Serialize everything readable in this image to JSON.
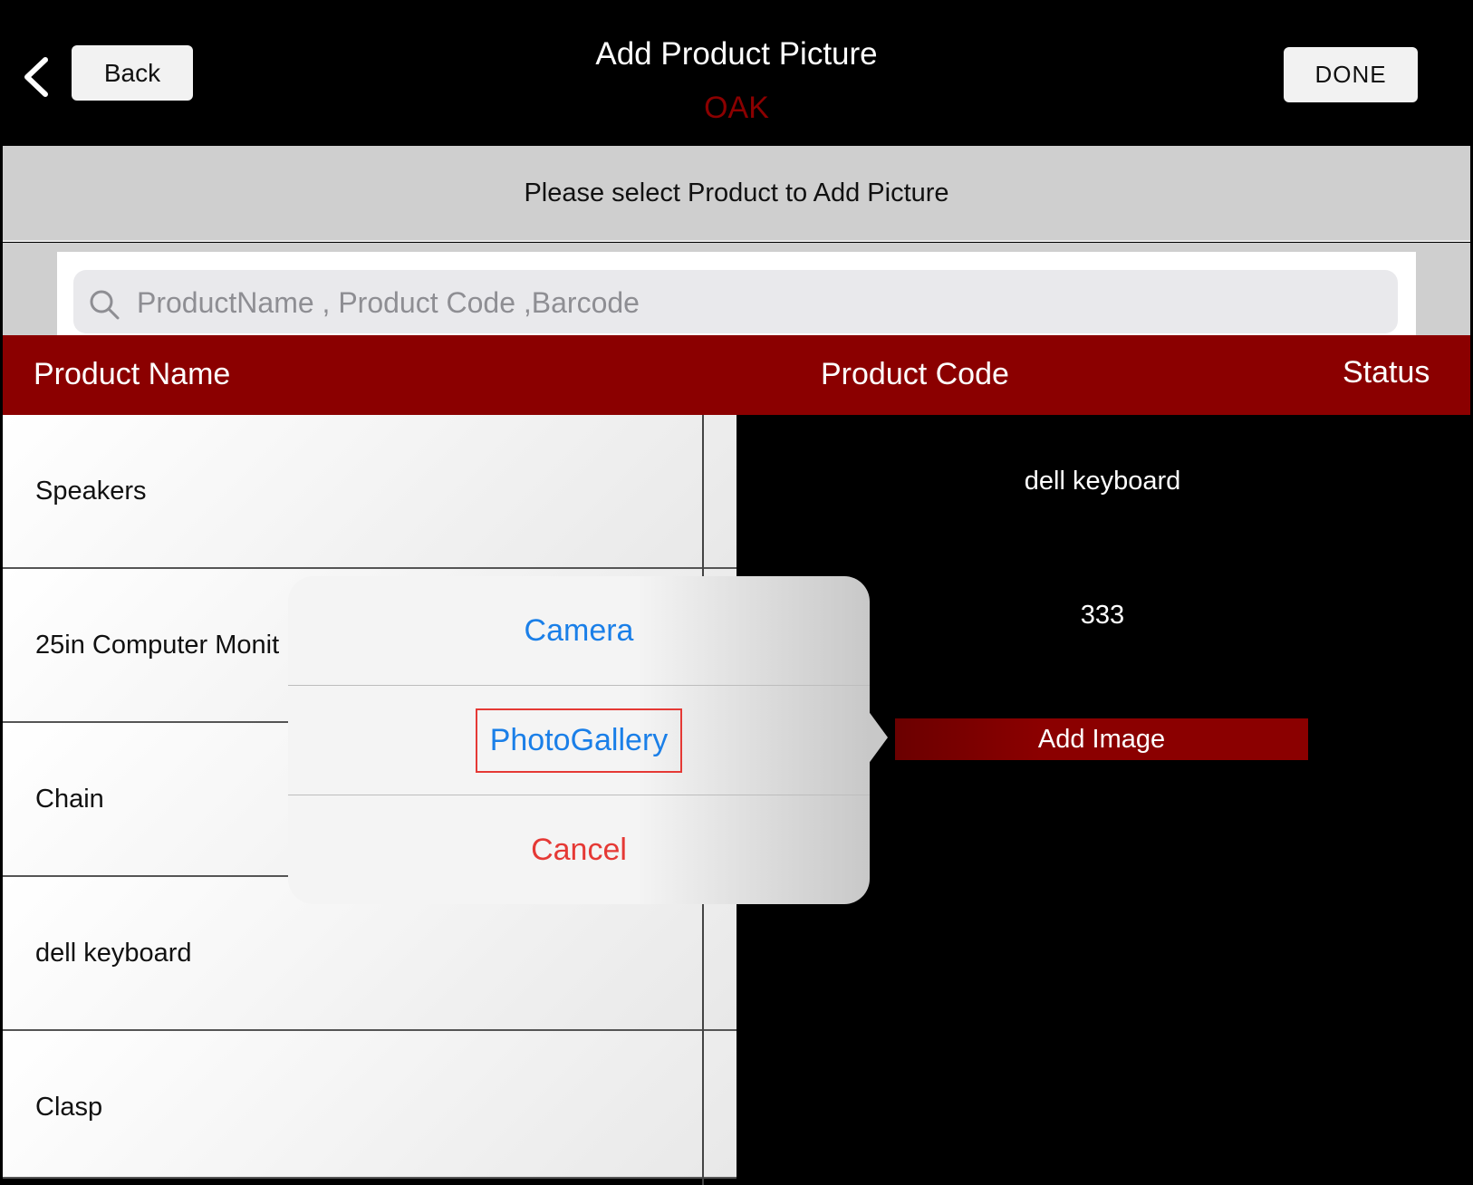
{
  "header": {
    "back_label": "Back",
    "title": "Add Product Picture",
    "subtitle": "OAK",
    "done_label": "DONE"
  },
  "instruction": "Please select Product to Add Picture",
  "search": {
    "placeholder": "ProductName , Product Code ,Barcode",
    "value": ""
  },
  "table": {
    "columns": [
      "Product Name",
      "Product Code",
      "Status"
    ],
    "rows": [
      "Speakers",
      "25in Computer Monit",
      "Chain",
      "dell keyboard",
      "Clasp"
    ]
  },
  "detail": {
    "name": "dell keyboard",
    "code": "333",
    "add_image_label": "Add Image"
  },
  "action_sheet": {
    "items": [
      "Camera",
      "PhotoGallery",
      "Cancel"
    ]
  },
  "colors": {
    "header_bg": "#000000",
    "accent": "#8b0000",
    "ios_blue": "#1a7fe8",
    "ios_red": "#e53935"
  },
  "icons": [
    "chevron-left-icon",
    "search-icon"
  ]
}
